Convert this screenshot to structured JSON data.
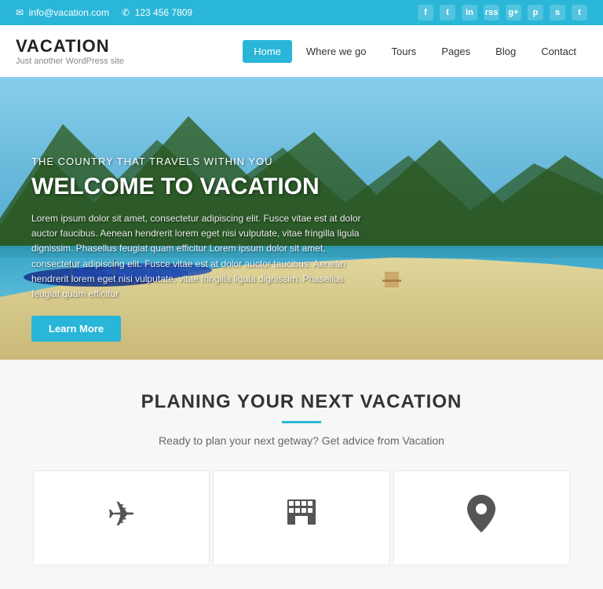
{
  "topbar": {
    "email": "info@vacation.com",
    "phone": "123 456 7809",
    "social": [
      "f",
      "t",
      "in",
      "rss",
      "g+",
      "p",
      "s",
      "t2"
    ]
  },
  "header": {
    "logo": "VACATION",
    "tagline": "Just another WordPress site",
    "nav": [
      {
        "label": "Home",
        "active": true
      },
      {
        "label": "Where we go",
        "active": false
      },
      {
        "label": "Tours",
        "active": false
      },
      {
        "label": "Pages",
        "active": false
      },
      {
        "label": "Blog",
        "active": false
      },
      {
        "label": "Contact",
        "active": false
      }
    ]
  },
  "hero": {
    "subtitle": "THE COUNTRY THAT TRAVELS WITHIN YOU",
    "title": "WELCOME TO VACATION",
    "body": "Lorem ipsum dolor sit amet, consectetur adipiscing elit. Fusce vitae est at dolor auctor faucibus. Aenean hendrerit lorem eget nisi vulputate, vitae fringilla ligula dignissim. Phasellus feugiat quam efficitur Lorem ipsum dolor sit amet, consectetur adipiscing elit. Fusce vitae est at dolor auctor taucibus. Aenean hendrerit lorem eget nisi vulputate, vitae fringilla ligula dignissim. Phasellus feugiat quam efficitur",
    "button": "Learn More"
  },
  "planning": {
    "title": "PLANING YOUR NEXT VACATION",
    "subtitle": "Ready to plan your next getway? Get advice from Vacation",
    "cards": [
      {
        "icon": "✈",
        "name": "flight"
      },
      {
        "icon": "▦",
        "name": "hotel"
      },
      {
        "icon": "📍",
        "name": "location"
      }
    ]
  }
}
